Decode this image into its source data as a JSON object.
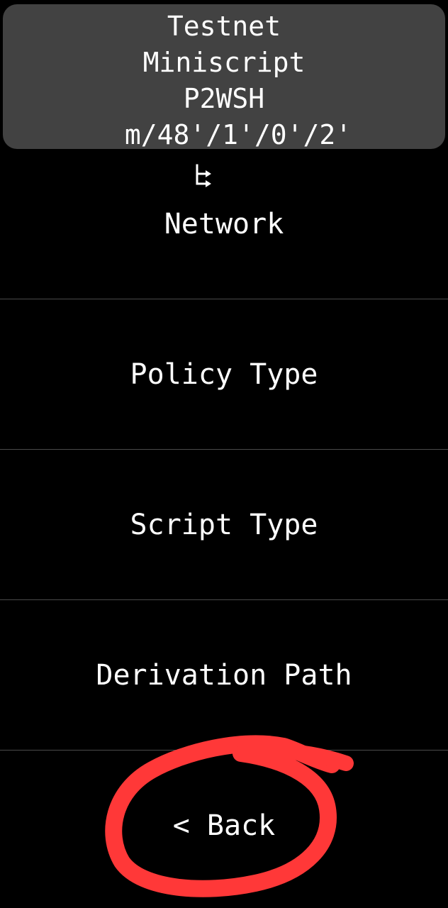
{
  "header": {
    "network": "Testnet",
    "policy_type": "Miniscript",
    "script_type": "P2WSH",
    "derivation_icon": "derivation-path-icon",
    "derivation_path": "m/48'/1'/0'/2'"
  },
  "menu": {
    "items": [
      {
        "label": "Network"
      },
      {
        "label": "Policy Type"
      },
      {
        "label": "Script Type"
      },
      {
        "label": "Derivation Path"
      },
      {
        "label": "< Back"
      }
    ]
  },
  "annotation": {
    "color": "#ff3838"
  },
  "colors": {
    "background": "#000000",
    "header_background": "#424242",
    "divider": "#4a4a4a",
    "text": "#ffffff"
  }
}
